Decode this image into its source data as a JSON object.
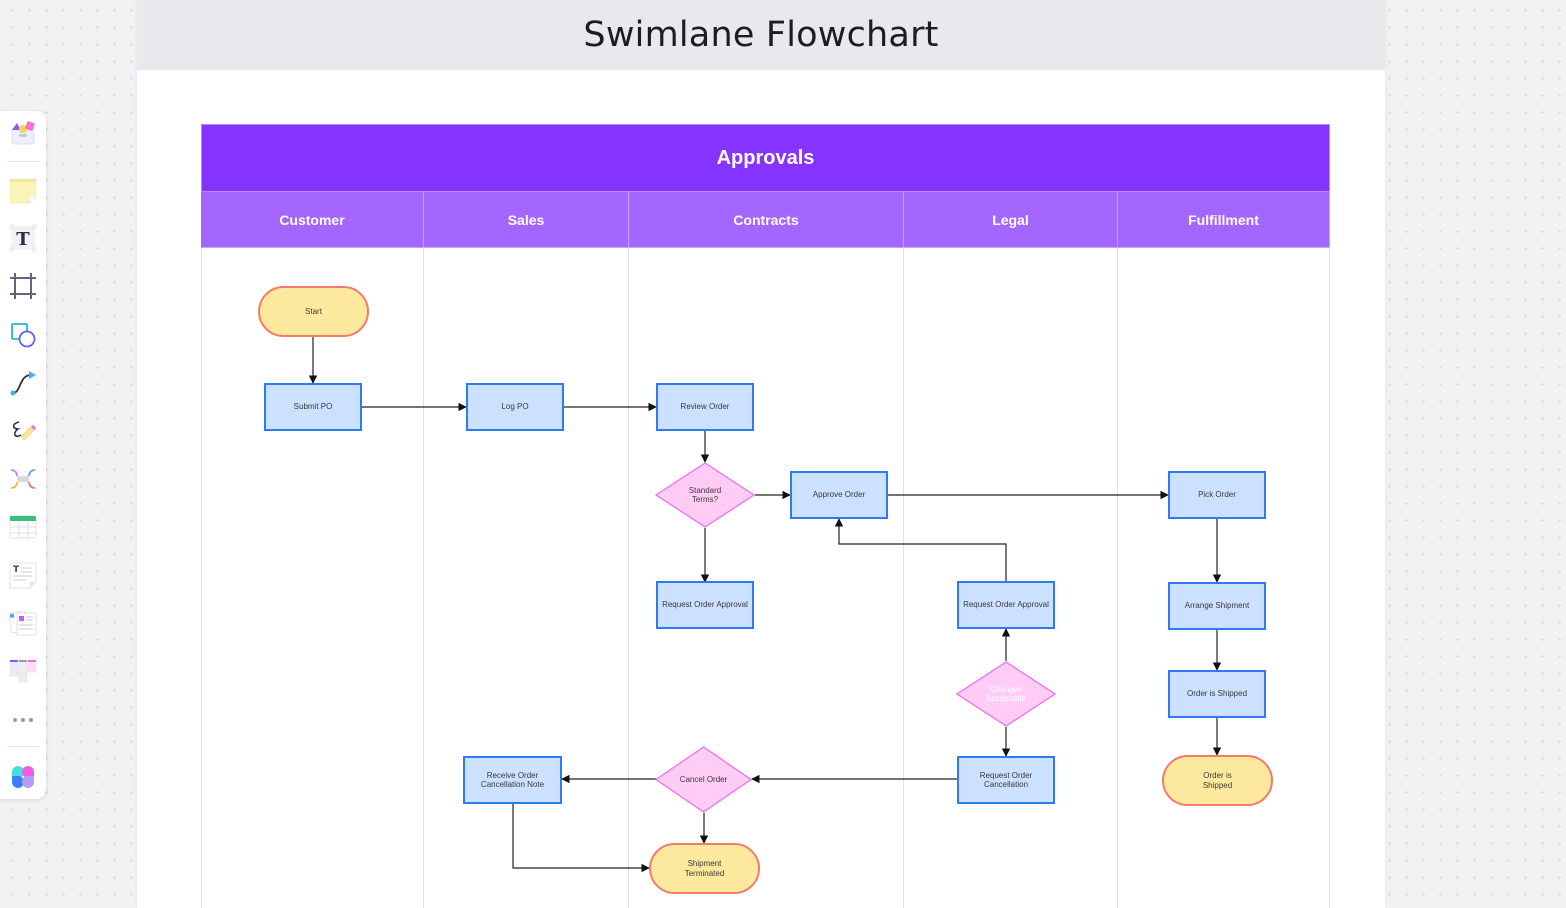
{
  "board": {
    "title": "Swimlane Flowchart"
  },
  "toolbar": {
    "tools": [
      {
        "name": "templates-icon",
        "label": "Templates"
      },
      {
        "name": "sticky-note-icon",
        "label": "Sticky note"
      },
      {
        "name": "text-icon",
        "label": "Text"
      },
      {
        "name": "frame-icon",
        "label": "Frame"
      },
      {
        "name": "shapes-icon",
        "label": "Shapes"
      },
      {
        "name": "connector-icon",
        "label": "Connector"
      },
      {
        "name": "pen-icon",
        "label": "Pen"
      },
      {
        "name": "mindmap-icon",
        "label": "Mind map"
      },
      {
        "name": "table-icon",
        "label": "Table"
      },
      {
        "name": "doc-icon",
        "label": "Document"
      },
      {
        "name": "cards-icon",
        "label": "Cards"
      },
      {
        "name": "kanban-icon",
        "label": "Kanban"
      },
      {
        "name": "more-icon",
        "label": "More"
      },
      {
        "name": "apps-icon",
        "label": "Apps"
      }
    ]
  },
  "swimlane": {
    "pool_title": "Approvals",
    "colors": {
      "pool": "#8533ff",
      "lane_header": "#a366ff",
      "process_fill": "#cce0ff",
      "process_stroke": "#2d7bf0",
      "terminal_fill": "#fde99e",
      "terminal_stroke": "#f47b6b",
      "decision_fill": "#ffccf5",
      "decision_stroke": "#f06ef0"
    },
    "lanes": [
      {
        "label": "Customer"
      },
      {
        "label": "Sales"
      },
      {
        "label": "Contracts"
      },
      {
        "label": "Legal"
      },
      {
        "label": "Fulfillment"
      }
    ]
  },
  "nodes": {
    "start": {
      "label": "Start",
      "type": "terminal",
      "lane": "Customer"
    },
    "submit_po": {
      "label": "Submit PO",
      "type": "process",
      "lane": "Customer"
    },
    "log_po": {
      "label": "Log PO",
      "type": "process",
      "lane": "Sales"
    },
    "review_order": {
      "label": "Review Order",
      "type": "process",
      "lane": "Contracts"
    },
    "standard_terms": {
      "label": "Standard Terms?",
      "type": "decision",
      "lane": "Contracts"
    },
    "approve_order": {
      "label": "Approve Order",
      "type": "process",
      "lane": "Contracts"
    },
    "request_approval_contracts": {
      "label": "Request Order Approval",
      "type": "process",
      "lane": "Contracts"
    },
    "request_approval_legal": {
      "label": "Request Order Approval",
      "type": "process",
      "lane": "Legal"
    },
    "changes_acceptable": {
      "label": "Changes Acceptable",
      "type": "decision",
      "lane": "Legal"
    },
    "request_cancellation": {
      "label": "Request Order Cancellation",
      "type": "process",
      "lane": "Legal"
    },
    "cancel_order": {
      "label": "Cancel Order",
      "type": "decision",
      "lane": "Contracts"
    },
    "receive_cancellation": {
      "label": "Receive Order Cancellation Note",
      "type": "process",
      "lane": "Sales"
    },
    "shipment_terminated": {
      "label": "Shipment Terminated",
      "type": "terminal",
      "lane": "Contracts"
    },
    "pick_order": {
      "label": "Pick Order",
      "type": "process",
      "lane": "Fulfillment"
    },
    "arrange_shipment": {
      "label": "Arrange Shipment",
      "type": "process",
      "lane": "Fulfillment"
    },
    "order_shipped_process": {
      "label": "Order is Shipped",
      "type": "process",
      "lane": "Fulfillment"
    },
    "order_shipped_end": {
      "label": "Order is Shipped",
      "type": "terminal",
      "lane": "Fulfillment"
    }
  },
  "edges": [
    {
      "from": "start",
      "to": "submit_po"
    },
    {
      "from": "submit_po",
      "to": "log_po"
    },
    {
      "from": "log_po",
      "to": "review_order"
    },
    {
      "from": "review_order",
      "to": "standard_terms"
    },
    {
      "from": "standard_terms",
      "to": "approve_order"
    },
    {
      "from": "standard_terms",
      "to": "request_approval_contracts"
    },
    {
      "from": "approve_order",
      "to": "pick_order"
    },
    {
      "from": "request_approval_legal",
      "to": "approve_order"
    },
    {
      "from": "changes_acceptable",
      "to": "request_approval_legal"
    },
    {
      "from": "changes_acceptable",
      "to": "request_cancellation"
    },
    {
      "from": "request_cancellation",
      "to": "cancel_order"
    },
    {
      "from": "cancel_order",
      "to": "receive_cancellation"
    },
    {
      "from": "cancel_order",
      "to": "shipment_terminated"
    },
    {
      "from": "receive_cancellation",
      "to": "shipment_terminated"
    },
    {
      "from": "pick_order",
      "to": "arrange_shipment"
    },
    {
      "from": "arrange_shipment",
      "to": "order_shipped_process"
    },
    {
      "from": "order_shipped_process",
      "to": "order_shipped_end"
    }
  ]
}
